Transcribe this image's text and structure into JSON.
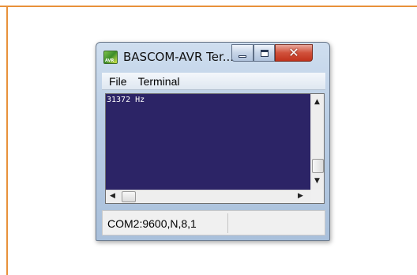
{
  "window": {
    "title": "BASCOM-AVR Ter...",
    "app_icon_text": "AVR",
    "buttons": {
      "minimize": "minimize",
      "maximize": "maximize",
      "close": "close"
    }
  },
  "menu": {
    "items": [
      {
        "label": "File"
      },
      {
        "label": "Terminal"
      }
    ]
  },
  "terminal": {
    "output": "31372 Hz",
    "background_color": "#2c2466",
    "text_color": "#ffffff"
  },
  "statusbar": {
    "port_settings": "COM2:9600,N,8,1",
    "second_pane": ""
  },
  "icons": {
    "app": "app-icon",
    "minimize": "minimize-icon",
    "maximize": "maximize-icon",
    "close": "close-icon",
    "scroll_up": "arrow-up-icon",
    "scroll_down": "arrow-down-icon",
    "scroll_left": "arrow-left-icon",
    "scroll_right": "arrow-right-icon"
  },
  "colors": {
    "frame_accent": "#e8913a",
    "close_button": "#c1321c",
    "terminal_bg": "#2c2466"
  }
}
